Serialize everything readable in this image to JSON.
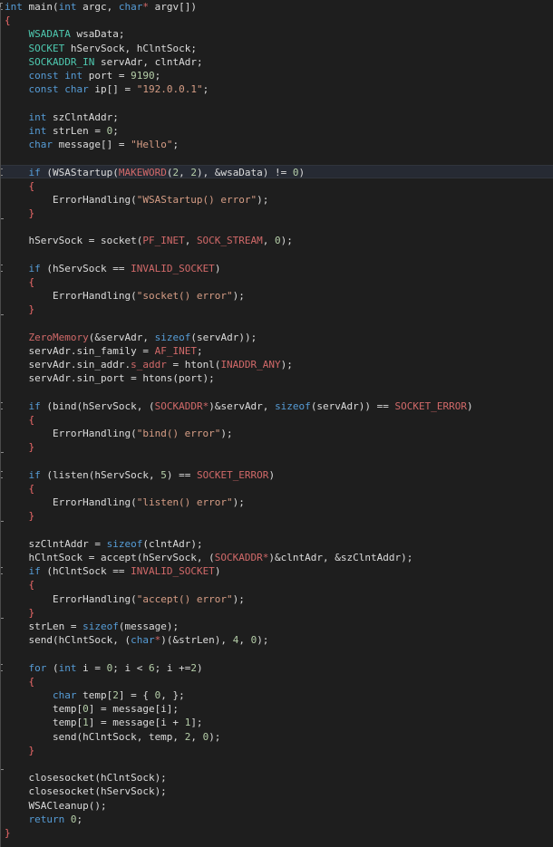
{
  "colors": {
    "background": "#1e1e1e",
    "current_line": "#262a33",
    "keyword": "#569cd6",
    "type": "#4ec9b0",
    "string": "#d69d85",
    "number": "#b5cea8",
    "macro": "#d16969",
    "text": "#dcdcdc"
  },
  "editor": {
    "current_line_index": 12,
    "lines": [
      [
        [
          "kw",
          "int"
        ],
        [
          "txt",
          " main("
        ],
        [
          "kw",
          "int"
        ],
        [
          "txt",
          " argc, "
        ],
        [
          "kw",
          "char"
        ],
        [
          "red",
          "*"
        ],
        [
          "txt",
          " argv[])"
        ]
      ],
      [
        [
          "br",
          "{"
        ]
      ],
      [
        [
          "txt",
          "    "
        ],
        [
          "type",
          "WSADATA"
        ],
        [
          "txt",
          " wsaData;"
        ]
      ],
      [
        [
          "txt",
          "    "
        ],
        [
          "type",
          "SOCKET"
        ],
        [
          "txt",
          " hServSock, hClntSock;"
        ]
      ],
      [
        [
          "txt",
          "    "
        ],
        [
          "type",
          "SOCKADDR_IN"
        ],
        [
          "txt",
          " servAdr, clntAdr;"
        ]
      ],
      [
        [
          "txt",
          "    "
        ],
        [
          "kw",
          "const"
        ],
        [
          "txt",
          " "
        ],
        [
          "kw",
          "int"
        ],
        [
          "txt",
          " port = "
        ],
        [
          "num",
          "9190"
        ],
        [
          "txt",
          ";"
        ]
      ],
      [
        [
          "txt",
          "    "
        ],
        [
          "kw",
          "const"
        ],
        [
          "txt",
          " "
        ],
        [
          "kw",
          "char"
        ],
        [
          "txt",
          " ip[] = "
        ],
        [
          "str",
          "\"192.0.0.1\""
        ],
        [
          "txt",
          ";"
        ]
      ],
      [],
      [
        [
          "txt",
          "    "
        ],
        [
          "kw",
          "int"
        ],
        [
          "txt",
          " szClntAddr;"
        ]
      ],
      [
        [
          "txt",
          "    "
        ],
        [
          "kw",
          "int"
        ],
        [
          "txt",
          " strLen = "
        ],
        [
          "num",
          "0"
        ],
        [
          "txt",
          ";"
        ]
      ],
      [
        [
          "txt",
          "    "
        ],
        [
          "kw",
          "char"
        ],
        [
          "txt",
          " message[] = "
        ],
        [
          "str",
          "\"Hello\""
        ],
        [
          "txt",
          ";"
        ]
      ],
      [],
      [
        [
          "txt",
          "    "
        ],
        [
          "kw",
          "if"
        ],
        [
          "txt",
          " (WSAStartup("
        ],
        [
          "red",
          "MAKEWORD"
        ],
        [
          "txt",
          "("
        ],
        [
          "num",
          "2"
        ],
        [
          "txt",
          ", "
        ],
        [
          "num",
          "2"
        ],
        [
          "txt",
          "), &wsaData) != "
        ],
        [
          "num",
          "0"
        ],
        [
          "txt",
          ")"
        ]
      ],
      [
        [
          "txt",
          "    "
        ],
        [
          "br",
          "{"
        ]
      ],
      [
        [
          "txt",
          "        ErrorHandling("
        ],
        [
          "str",
          "\"WSAStartup() error\""
        ],
        [
          "txt",
          ");"
        ]
      ],
      [
        [
          "txt",
          "    "
        ],
        [
          "br",
          "}"
        ]
      ],
      [],
      [
        [
          "txt",
          "    hServSock = socket("
        ],
        [
          "red",
          "PF_INET"
        ],
        [
          "txt",
          ", "
        ],
        [
          "red",
          "SOCK_STREAM"
        ],
        [
          "txt",
          ", "
        ],
        [
          "num",
          "0"
        ],
        [
          "txt",
          ");"
        ]
      ],
      [],
      [
        [
          "txt",
          "    "
        ],
        [
          "kw",
          "if"
        ],
        [
          "txt",
          " (hServSock == "
        ],
        [
          "red",
          "INVALID_SOCKET"
        ],
        [
          "txt",
          ")"
        ]
      ],
      [
        [
          "txt",
          "    "
        ],
        [
          "br",
          "{"
        ]
      ],
      [
        [
          "txt",
          "        ErrorHandling("
        ],
        [
          "str",
          "\"socket() error\""
        ],
        [
          "txt",
          ");"
        ]
      ],
      [
        [
          "txt",
          "    "
        ],
        [
          "br",
          "}"
        ]
      ],
      [],
      [
        [
          "txt",
          "    "
        ],
        [
          "red",
          "ZeroMemory"
        ],
        [
          "txt",
          "(&servAdr, "
        ],
        [
          "kw",
          "sizeof"
        ],
        [
          "txt",
          "(servAdr));"
        ]
      ],
      [
        [
          "txt",
          "    servAdr.sin_family = "
        ],
        [
          "red",
          "AF_INET"
        ],
        [
          "txt",
          ";"
        ]
      ],
      [
        [
          "txt",
          "    servAdr.sin_addr."
        ],
        [
          "red",
          "s_addr"
        ],
        [
          "txt",
          " = htonl("
        ],
        [
          "red",
          "INADDR_ANY"
        ],
        [
          "txt",
          ");"
        ]
      ],
      [
        [
          "txt",
          "    servAdr.sin_port = htons(port);"
        ]
      ],
      [],
      [
        [
          "txt",
          "    "
        ],
        [
          "kw",
          "if"
        ],
        [
          "txt",
          " (bind(hServSock, ("
        ],
        [
          "red",
          "SOCKADDR*"
        ],
        [
          "txt",
          ")&servAdr, "
        ],
        [
          "kw",
          "sizeof"
        ],
        [
          "txt",
          "(servAdr)) == "
        ],
        [
          "red",
          "SOCKET_ERROR"
        ],
        [
          "txt",
          ")"
        ]
      ],
      [
        [
          "txt",
          "    "
        ],
        [
          "br",
          "{"
        ]
      ],
      [
        [
          "txt",
          "        ErrorHandling("
        ],
        [
          "str",
          "\"bind() error\""
        ],
        [
          "txt",
          ");"
        ]
      ],
      [
        [
          "txt",
          "    "
        ],
        [
          "br",
          "}"
        ]
      ],
      [],
      [
        [
          "txt",
          "    "
        ],
        [
          "kw",
          "if"
        ],
        [
          "txt",
          " (listen(hServSock, "
        ],
        [
          "num",
          "5"
        ],
        [
          "txt",
          ") == "
        ],
        [
          "red",
          "SOCKET_ERROR"
        ],
        [
          "txt",
          ")"
        ]
      ],
      [
        [
          "txt",
          "    "
        ],
        [
          "br",
          "{"
        ]
      ],
      [
        [
          "txt",
          "        ErrorHandling("
        ],
        [
          "str",
          "\"listen() error\""
        ],
        [
          "txt",
          ");"
        ]
      ],
      [
        [
          "txt",
          "    "
        ],
        [
          "br",
          "}"
        ]
      ],
      [],
      [
        [
          "txt",
          "    szClntAddr = "
        ],
        [
          "kw",
          "sizeof"
        ],
        [
          "txt",
          "(clntAdr);"
        ]
      ],
      [
        [
          "txt",
          "    hClntSock = accept(hServSock, ("
        ],
        [
          "red",
          "SOCKADDR*"
        ],
        [
          "txt",
          ")&clntAdr, &szClntAddr);"
        ]
      ],
      [
        [
          "txt",
          "    "
        ],
        [
          "kw",
          "if"
        ],
        [
          "txt",
          " (hClntSock == "
        ],
        [
          "red",
          "INVALID_SOCKET"
        ],
        [
          "txt",
          ")"
        ]
      ],
      [
        [
          "txt",
          "    "
        ],
        [
          "br",
          "{"
        ]
      ],
      [
        [
          "txt",
          "        ErrorHandling("
        ],
        [
          "str",
          "\"accept() error\""
        ],
        [
          "txt",
          ");"
        ]
      ],
      [
        [
          "txt",
          "    "
        ],
        [
          "br",
          "}"
        ]
      ],
      [
        [
          "txt",
          "    strLen = "
        ],
        [
          "kw",
          "sizeof"
        ],
        [
          "txt",
          "(message);"
        ]
      ],
      [
        [
          "txt",
          "    send(hClntSock, ("
        ],
        [
          "kw",
          "char"
        ],
        [
          "red",
          "*"
        ],
        [
          "txt",
          ")(&strLen), "
        ],
        [
          "num",
          "4"
        ],
        [
          "txt",
          ", "
        ],
        [
          "num",
          "0"
        ],
        [
          "txt",
          ");"
        ]
      ],
      [],
      [
        [
          "txt",
          "    "
        ],
        [
          "kw",
          "for"
        ],
        [
          "txt",
          " ("
        ],
        [
          "kw",
          "int"
        ],
        [
          "txt",
          " i = "
        ],
        [
          "num",
          "0"
        ],
        [
          "txt",
          "; i < "
        ],
        [
          "num",
          "6"
        ],
        [
          "txt",
          "; i +="
        ],
        [
          "num",
          "2"
        ],
        [
          "txt",
          ")"
        ]
      ],
      [
        [
          "txt",
          "    "
        ],
        [
          "br",
          "{"
        ]
      ],
      [
        [
          "txt",
          "        "
        ],
        [
          "kw",
          "char"
        ],
        [
          "txt",
          " temp["
        ],
        [
          "num",
          "2"
        ],
        [
          "txt",
          "] = { "
        ],
        [
          "num",
          "0"
        ],
        [
          "txt",
          ", };"
        ]
      ],
      [
        [
          "txt",
          "        temp["
        ],
        [
          "num",
          "0"
        ],
        [
          "txt",
          "] = message[i];"
        ]
      ],
      [
        [
          "txt",
          "        temp["
        ],
        [
          "num",
          "1"
        ],
        [
          "txt",
          "] = message[i + "
        ],
        [
          "num",
          "1"
        ],
        [
          "txt",
          "];"
        ]
      ],
      [
        [
          "txt",
          "        send(hClntSock, temp, "
        ],
        [
          "num",
          "2"
        ],
        [
          "txt",
          ", "
        ],
        [
          "num",
          "0"
        ],
        [
          "txt",
          ");"
        ]
      ],
      [
        [
          "txt",
          "    "
        ],
        [
          "br",
          "}"
        ]
      ],
      [],
      [
        [
          "txt",
          "    closesocket(hClntSock);"
        ]
      ],
      [
        [
          "txt",
          "    closesocket(hServSock);"
        ]
      ],
      [
        [
          "txt",
          "    WSACleanup();"
        ]
      ],
      [
        [
          "txt",
          "    "
        ],
        [
          "kw",
          "return"
        ],
        [
          "txt",
          " "
        ],
        [
          "num",
          "0"
        ],
        [
          "txt",
          ";"
        ]
      ],
      [
        [
          "br",
          "}"
        ]
      ]
    ]
  }
}
